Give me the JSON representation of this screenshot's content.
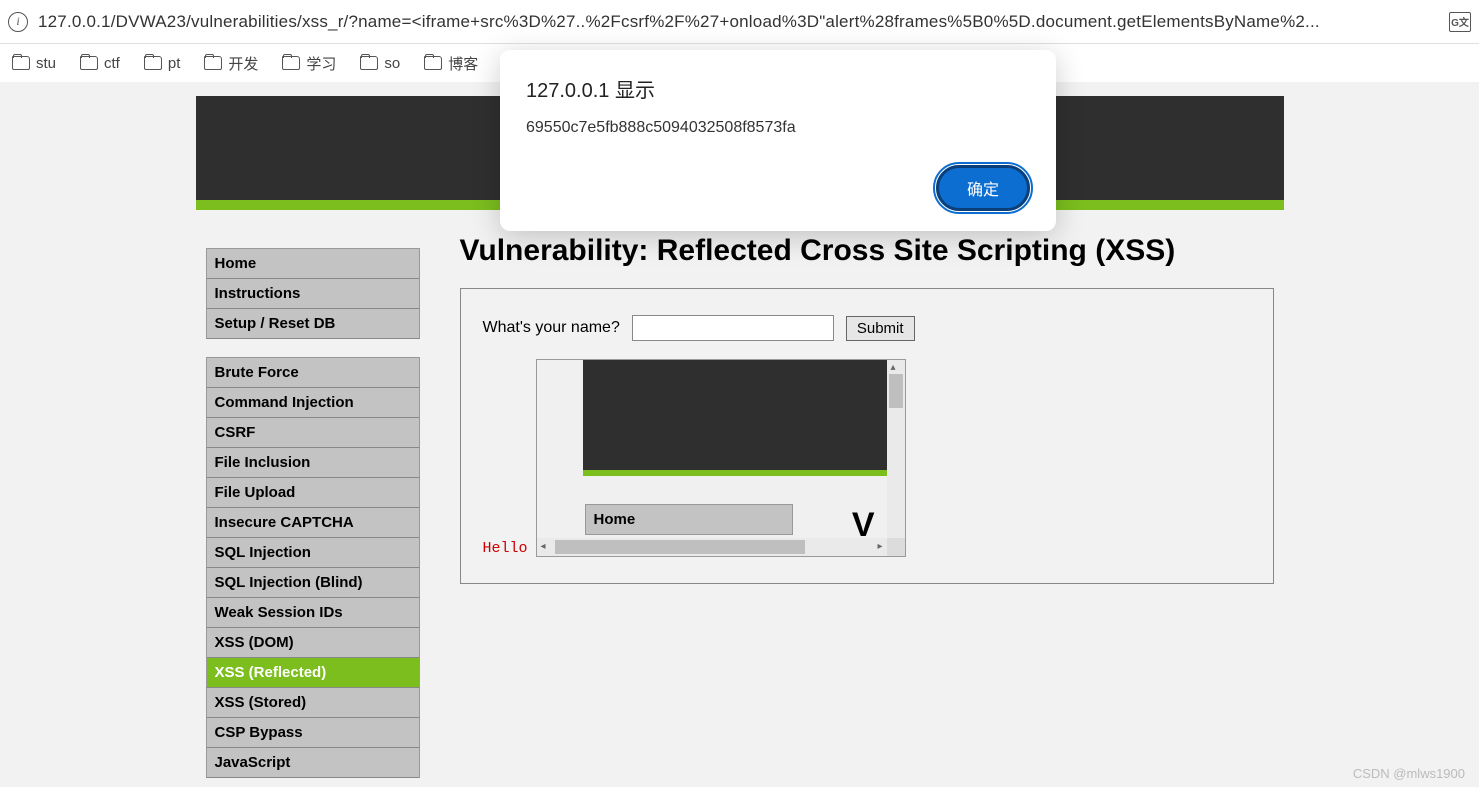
{
  "addr": {
    "url": "127.0.0.1/DVWA23/vulnerabilities/xss_r/?name=<iframe+src%3D%27..%2Fcsrf%2F%27+onload%3D\"alert%28frames%5B0%5D.document.getElementsByName%2..."
  },
  "bookmarks": [
    "stu",
    "ctf",
    "pt",
    "开发",
    "学习",
    "so",
    "博客"
  ],
  "dialog": {
    "title": "127.0.0.1 显示",
    "message": "69550c7e5fb888c5094032508f8573fa",
    "ok": "确定"
  },
  "sidebar": {
    "group1": [
      "Home",
      "Instructions",
      "Setup / Reset DB"
    ],
    "group2": [
      "Brute Force",
      "Command Injection",
      "CSRF",
      "File Inclusion",
      "File Upload",
      "Insecure CAPTCHA",
      "SQL Injection",
      "SQL Injection (Blind)",
      "Weak Session IDs",
      "XSS (DOM)",
      "XSS (Reflected)",
      "XSS (Stored)",
      "CSP Bypass",
      "JavaScript"
    ],
    "active": "XSS (Reflected)"
  },
  "content": {
    "heading": "Vulnerability: Reflected Cross Site Scripting (XSS)",
    "label": "What's your name?",
    "submit": "Submit",
    "hello": "Hello",
    "iframe_home": "Home",
    "iframe_v": "V"
  },
  "watermark": "CSDN @mlws1900"
}
